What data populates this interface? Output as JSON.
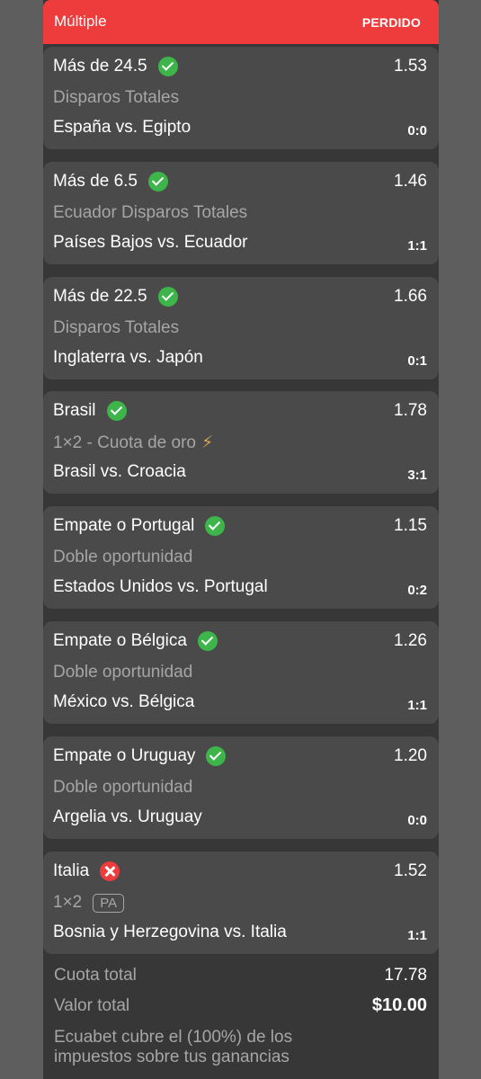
{
  "header": {
    "title": "Múltiple",
    "status": "PERDIDO",
    "status_color": "#ee3b3b"
  },
  "legs": [
    {
      "selection": "Más de 24.5",
      "result": "won",
      "result_icon": "check-icon",
      "odds": "1.53",
      "market": "Disparos Totales",
      "match": "España vs. Egipto",
      "score": "0:0"
    },
    {
      "selection": "Más de 6.5",
      "result": "won",
      "result_icon": "check-icon",
      "odds": "1.46",
      "market": "Ecuador Disparos Totales",
      "match": "Países Bajos vs. Ecuador",
      "score": "1:1"
    },
    {
      "selection": "Más de 22.5",
      "result": "won",
      "result_icon": "check-icon",
      "odds": "1.66",
      "market": "Disparos Totales",
      "match": "Inglaterra vs. Japón",
      "score": "0:1"
    },
    {
      "selection": "Brasil",
      "result": "won",
      "result_icon": "check-icon",
      "odds": "1.78",
      "market": "1×2 - Cuota de oro",
      "market_icon": "lightning-icon",
      "match": "Brasil vs. Croacia",
      "score": "3:1"
    },
    {
      "selection": "Empate o Portugal",
      "result": "won",
      "result_icon": "check-icon",
      "odds": "1.15",
      "market": "Doble oportunidad",
      "match": "Estados Unidos vs. Portugal",
      "score": "0:2"
    },
    {
      "selection": "Empate o Bélgica",
      "result": "won",
      "result_icon": "check-icon",
      "odds": "1.26",
      "market": "Doble oportunidad",
      "match": "México vs. Bélgica",
      "score": "1:1"
    },
    {
      "selection": "Empate o Uruguay",
      "result": "won",
      "result_icon": "check-icon",
      "odds": "1.20",
      "market": "Doble oportunidad",
      "match": "Argelia vs. Uruguay",
      "score": "0:0"
    },
    {
      "selection": "Italia",
      "result": "lost",
      "result_icon": "cross-icon",
      "odds": "1.52",
      "market": "1×2",
      "badge": "PA",
      "match": "Bosnia y Herzegovina vs. Italia",
      "score": "1:1"
    }
  ],
  "summary": {
    "total_odds_label": "Cuota total",
    "total_odds_value": "17.78",
    "total_value_label": "Valor total",
    "total_value_value": "$10.00",
    "tax_note": "Ecuabet cubre el (100%) de los impuestos sobre tus ganancias"
  },
  "colors": {
    "won": "#3db54a",
    "lost": "#ee3b3b",
    "card": "#4a4a4a",
    "panel": "#373737",
    "muted": "#a6a6a6"
  }
}
